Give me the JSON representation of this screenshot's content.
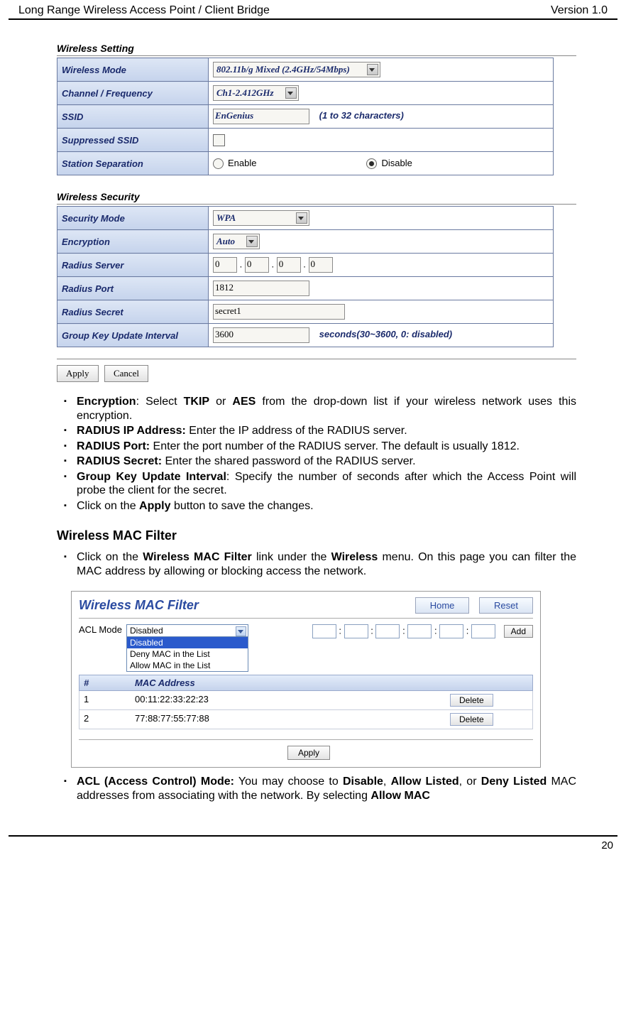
{
  "header": {
    "left": "Long Range Wireless Access Point / Client Bridge",
    "right": "Version 1.0"
  },
  "ws": {
    "section": "Wireless Setting",
    "mode_label": "Wireless Mode",
    "mode_val": "802.11b/g Mixed (2.4GHz/54Mbps)",
    "chan_label": "Channel / Frequency",
    "chan_val": "Ch1-2.412GHz",
    "ssid_label": "SSID",
    "ssid_val": "EnGenius",
    "ssid_hint": "(1 to 32 characters)",
    "supp_label": "Suppressed SSID",
    "sep_label": "Station Separation",
    "sep_enable": "Enable",
    "sep_disable": "Disable"
  },
  "sec": {
    "section": "Wireless Security",
    "mode_label": "Security Mode",
    "mode_val": "WPA",
    "enc_label": "Encryption",
    "enc_val": "Auto",
    "radsrv_label": "Radius Server",
    "ip": [
      "0",
      "0",
      "0",
      "0"
    ],
    "radport_label": "Radius Port",
    "radport_val": "1812",
    "radsec_label": "Radius Secret",
    "radsec_val": "secret1",
    "gku_label": "Group Key Update Interval",
    "gku_val": "3600",
    "gku_hint": "seconds(30~3600, 0: disabled)"
  },
  "btn": {
    "apply": "Apply",
    "cancel": "Cancel"
  },
  "bul1": {
    "a1": "Encryption",
    "a2": ": Select ",
    "a3": "TKIP",
    "a4": " or ",
    "a5": "AES",
    "a6": " from the drop-down list if your wireless network uses this encryption.",
    "b1": "RADIUS IP Address:",
    "b2": " Enter the IP address of the RADIUS server.",
    "c1": "RADIUS Port:",
    "c2": " Enter the port number of the RADIUS server. The default is usually 1812.",
    "d1": "RADIUS Secret:",
    "d2": " Enter the shared password of the RADIUS server.",
    "e1": "Group Key Update Interval",
    "e2": ": Specify the number of seconds after which the Access Point will probe the client for the secret.",
    "f1": "Click on the ",
    "f2": "Apply",
    "f3": " button to save the changes."
  },
  "mf_head": "Wireless MAC Filter",
  "bul2": {
    "a1": "Click on the ",
    "a2": "Wireless MAC Filter",
    "a3": " link under the ",
    "a4": "Wireless",
    "a5": " menu. On this page you can filter the MAC address by allowing or blocking access the network."
  },
  "mf": {
    "title": "Wireless MAC Filter",
    "home": "Home",
    "reset": "Reset",
    "acl_label": "ACL Mode",
    "opt_sel": "Disabled",
    "opts": [
      "Disabled",
      "Deny MAC in the List",
      "Allow MAC in the List"
    ],
    "add": "Add",
    "col_num": "#",
    "col_mac": "MAC Address",
    "rows": [
      {
        "n": "1",
        "mac": "00:11:22:33:22:23"
      },
      {
        "n": "2",
        "mac": "77:88:77:55:77:88"
      }
    ],
    "del": "Delete",
    "apply": "Apply"
  },
  "bul3": {
    "a1": "ACL (Access Control) Mode:",
    "a2": " You may choose to ",
    "a3": "Disable",
    "a4": ", ",
    "a5": "Allow Listed",
    "a6": ", or ",
    "a7": "Deny Listed",
    "a8": " MAC addresses from associating with the network. By selecting ",
    "a9": "Allow MAC"
  },
  "footer": {
    "page": "20"
  }
}
